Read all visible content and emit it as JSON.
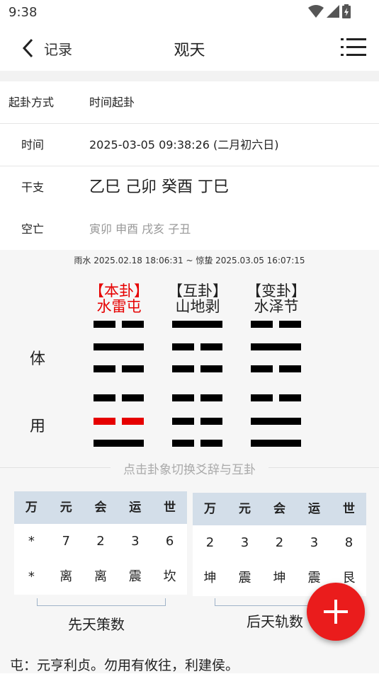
{
  "status": {
    "time": "9:38"
  },
  "appbar": {
    "back_label": "记录",
    "title": "观天"
  },
  "info": {
    "method": {
      "label": "起卦方式",
      "value": "时间起卦"
    },
    "time": {
      "label": "时间",
      "value": "2025-03-05 09:38:26 (二月初六日)"
    },
    "ganzhi": {
      "label": "干支",
      "value": "乙巳 己卯 癸酉 丁巳"
    },
    "kongwang": {
      "label": "空亡",
      "value": "寅卯 申酉 戌亥 子丑"
    }
  },
  "jieqi": "雨水 2025.02.18 18:06:31 ~ 惊蛰 2025.03.05 16:07:15",
  "hexagrams": {
    "ben": {
      "tag": "【本卦】",
      "name": "水雷屯",
      "color": "#e60000"
    },
    "hu": {
      "tag": "【互卦】",
      "name": "山地剥"
    },
    "bian": {
      "tag": "【变卦】",
      "name": "水泽节"
    }
  },
  "lines": {
    "ben": [
      "yin",
      "yang",
      "yin",
      "yin",
      "yin",
      "yang"
    ],
    "hu": [
      "yang",
      "yin",
      "yin",
      "yin",
      "yin",
      "yin"
    ],
    "bian": [
      "yin",
      "yang",
      "yin",
      "yin",
      "yang",
      "yang"
    ],
    "moving_index": 4,
    "moving_color": "#e60000"
  },
  "tiyong": {
    "ti": "体",
    "yong": "用"
  },
  "hint": "点击卦象切换爻辞与互卦",
  "xiantian": {
    "headers": [
      "万",
      "元",
      "会",
      "运",
      "世"
    ],
    "numbers": [
      "*",
      "7",
      "2",
      "3",
      "6"
    ],
    "trigrams": [
      "*",
      "离",
      "离",
      "震",
      "坎"
    ],
    "label": "先天策数"
  },
  "houtian": {
    "headers": [
      "万",
      "元",
      "会",
      "运",
      "世"
    ],
    "numbers": [
      "2",
      "3",
      "2",
      "3",
      "8"
    ],
    "trigrams": [
      "坤",
      "震",
      "坤",
      "震",
      "艮"
    ],
    "label": "后天轨数"
  },
  "colors": {
    "header_bg": "#d3dee9",
    "fab": "#ea1c1c"
  },
  "fab_icon": "plus-icon",
  "judgement": "屯：元亨利贞。勿用有攸往，利建侯。"
}
